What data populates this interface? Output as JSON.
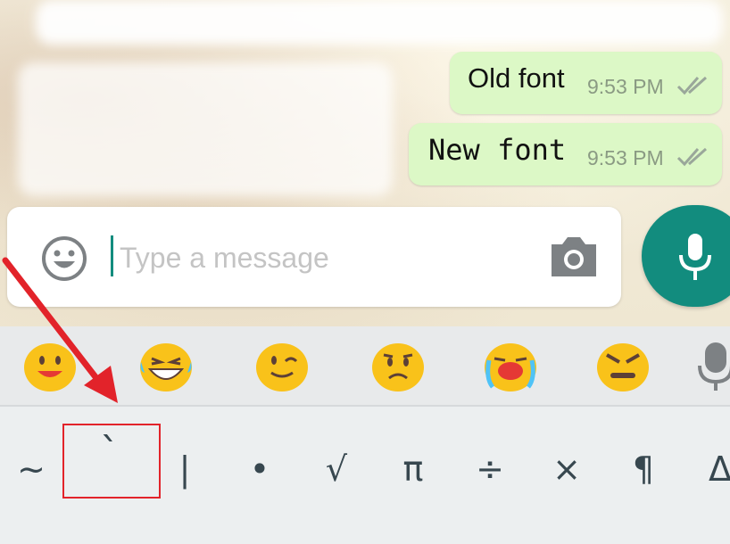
{
  "chat": {
    "messages": [
      {
        "text": "Old font",
        "time": "9:53 PM",
        "status_icon": "double-check-icon"
      },
      {
        "text": "New font",
        "time": "9:53 PM",
        "status_icon": "double-check-icon"
      }
    ]
  },
  "composer": {
    "placeholder": "Type a message",
    "emoji_icon": "smiley-icon",
    "camera_icon": "camera-icon",
    "send_icon": "microphone-icon",
    "accent_color": "#128c7e"
  },
  "keyboard": {
    "emoji_suggestions": [
      "smiling-face",
      "laughing-tears-face",
      "winking-face",
      "frowning-face",
      "loudly-crying-face",
      "angry-face"
    ],
    "symbol_keys": [
      "~",
      "`",
      "|",
      "•",
      "√",
      "π",
      "÷",
      "×",
      "¶",
      "Δ"
    ],
    "highlighted_key": "`",
    "highlight_color": "#e2232a"
  }
}
